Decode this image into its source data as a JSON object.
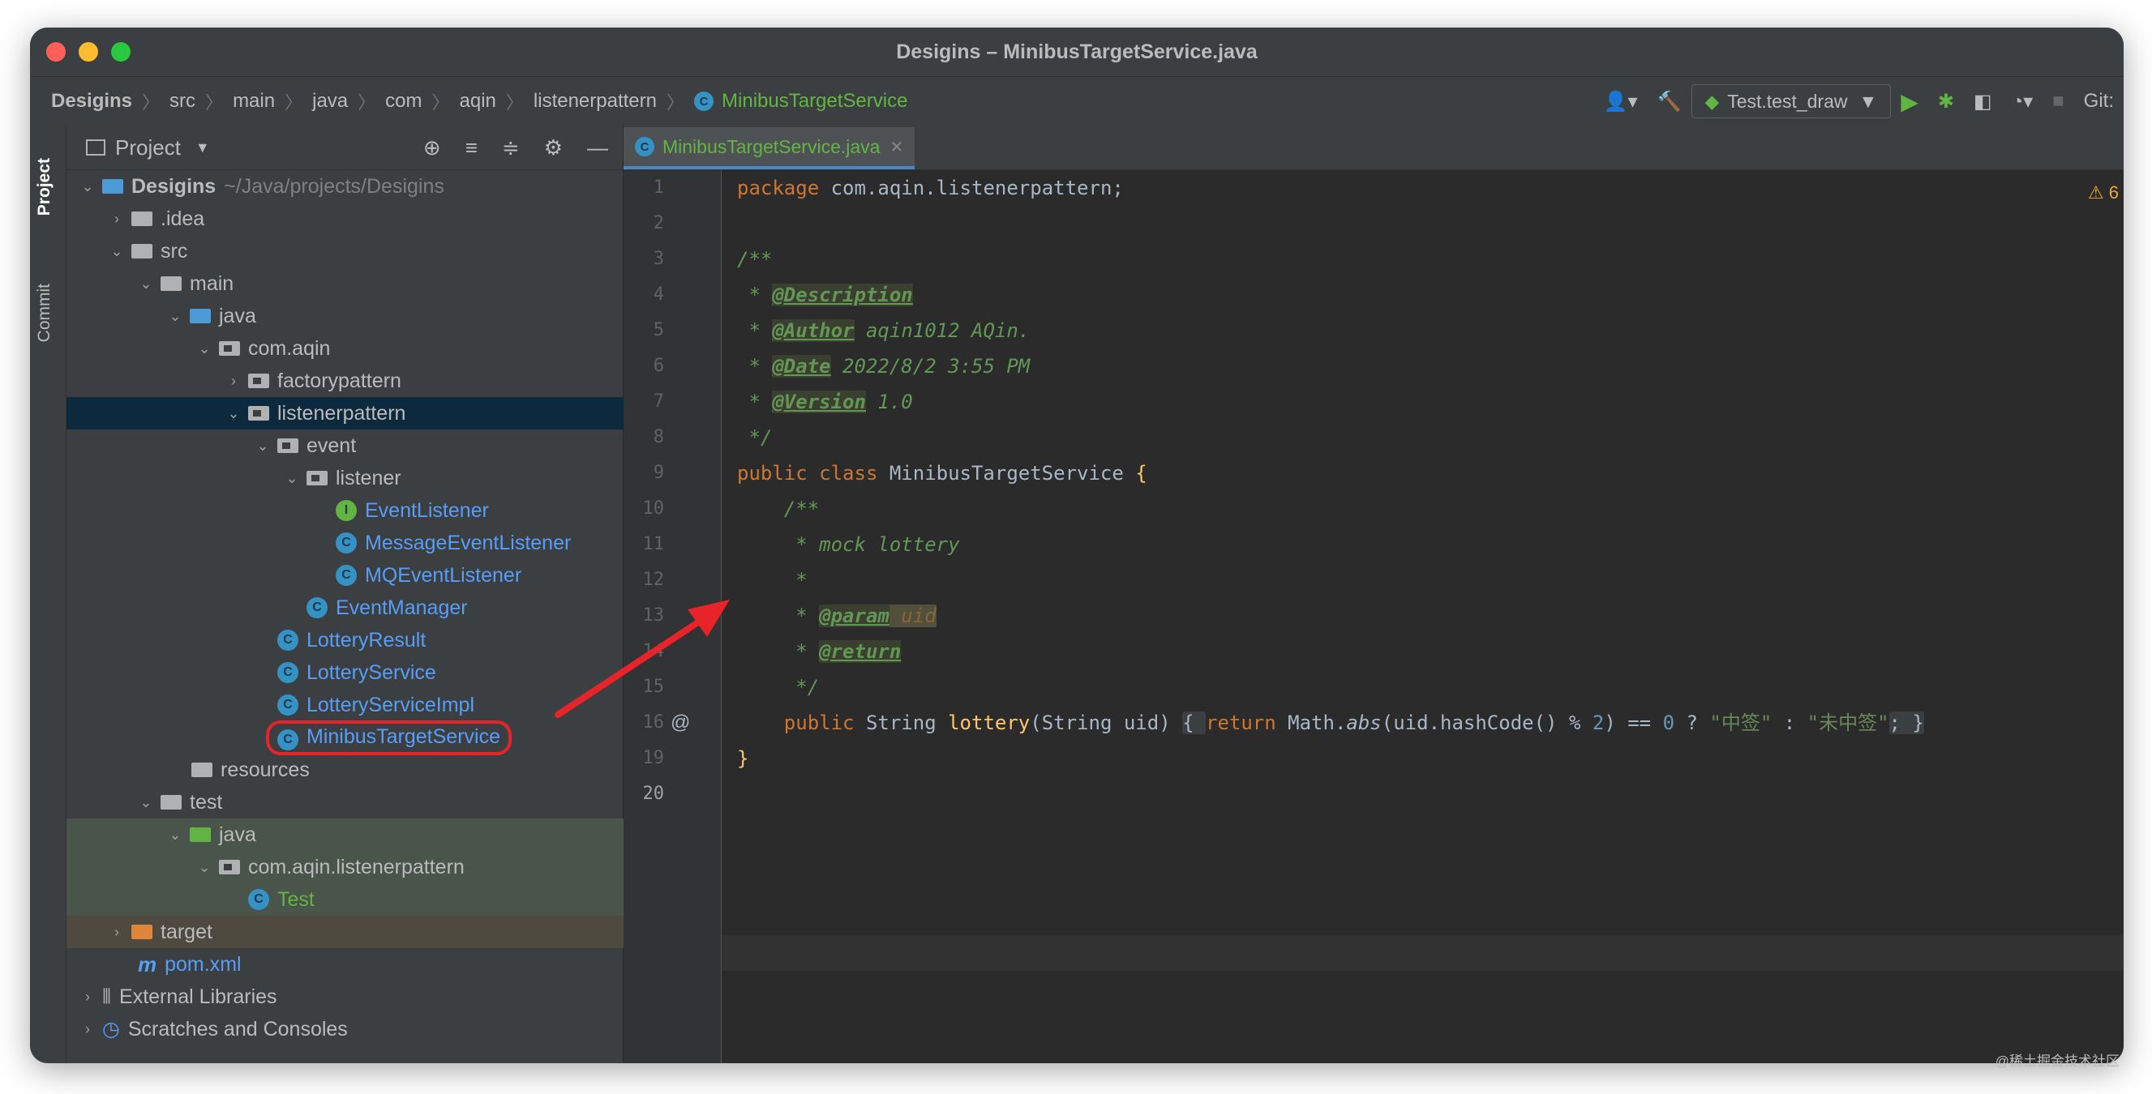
{
  "window": {
    "title": "Desigins – MinibusTargetService.java"
  },
  "breadcrumbs": [
    "Desigins",
    "src",
    "main",
    "java",
    "com",
    "aqin",
    "listenerpattern",
    "MinibusTargetService"
  ],
  "toolbar": {
    "run_config": "Test.test_draw",
    "vcs_label": "Git:"
  },
  "side_stripe": {
    "project": "Project",
    "commit": "Commit"
  },
  "project_panel": {
    "title": "Project"
  },
  "tree": {
    "root_name": "Desigins",
    "root_path": "~/Java/projects/Desigins",
    "idea": ".idea",
    "src": "src",
    "main": "main",
    "java": "java",
    "com_aqin": "com.aqin",
    "factorypattern": "factorypattern",
    "listenerpattern": "listenerpattern",
    "event": "event",
    "listener": "listener",
    "event_listener": "EventListener",
    "message_event_listener": "MessageEventListener",
    "mq_event_listener": "MQEventListener",
    "event_manager": "EventManager",
    "lottery_result": "LotteryResult",
    "lottery_service": "LotteryService",
    "lottery_service_impl": "LotteryServiceImpl",
    "minibus_target_service": "MinibusTargetService",
    "resources": "resources",
    "test": "test",
    "test_java": "java",
    "test_pkg": "com.aqin.listenerpattern",
    "test_class": "Test",
    "target": "target",
    "pom": "pom.xml",
    "external_libraries": "External Libraries",
    "scratches": "Scratches and Consoles"
  },
  "editor": {
    "tab_label": "MinibusTargetService.java",
    "warning_count": "6",
    "line_numbers": [
      "1",
      "2",
      "3",
      "4",
      "5",
      "6",
      "7",
      "8",
      "9",
      "10",
      "11",
      "12",
      "13",
      "14",
      "15",
      "16",
      "19",
      "20"
    ],
    "code": {
      "l1_kw": "package",
      "l1_rest": " com.aqin.listenerpattern;",
      "l3": "/**",
      "l4_pre": " * ",
      "l4_tag": "@Description",
      "l5_pre": " * ",
      "l5_tag": "@Author",
      "l5_rest": " aqin1012 AQin.",
      "l6_pre": " * ",
      "l6_tag": "@Date",
      "l6_rest": " 2022/8/2 3:55 PM",
      "l7_pre": " * ",
      "l7_tag": "@Version",
      "l7_rest": " 1.0",
      "l8": " */",
      "l9_kw": "public class",
      "l9_name": " MinibusTargetService ",
      "l9_brace": "{",
      "l10": "    /**",
      "l11": "     * mock lottery",
      "l12": "     *",
      "l13_pre": "     * ",
      "l13_tag": "@param",
      "l13_arg": " uid",
      "l14_pre": "     * ",
      "l14_tag": "@return",
      "l15": "     */",
      "l16_indent": "    ",
      "l16_kw": "public",
      "l16_type": " String ",
      "l16_fn": "lottery",
      "l16_params": "(String uid) ",
      "l16_brace_open": "{ ",
      "l16_return": "return",
      "l16_math": " Math.",
      "l16_abs": "abs",
      "l16_expr": "(uid.hashCode() % ",
      "l16_two": "2",
      "l16_eq": ") == ",
      "l16_zero": "0",
      "l16_tern": " ? ",
      "l16_s1": "\"中签\"",
      "l16_colon": " : ",
      "l16_s2": "\"未中签\"",
      "l16_end": "; }",
      "l19": "}",
      "at_marker": "@"
    }
  },
  "watermark": "@稀土掘金技术社区",
  "colors": {
    "selection": "#0d293e",
    "annotation_red": "#e8232a",
    "accent": "#4a88c7"
  }
}
